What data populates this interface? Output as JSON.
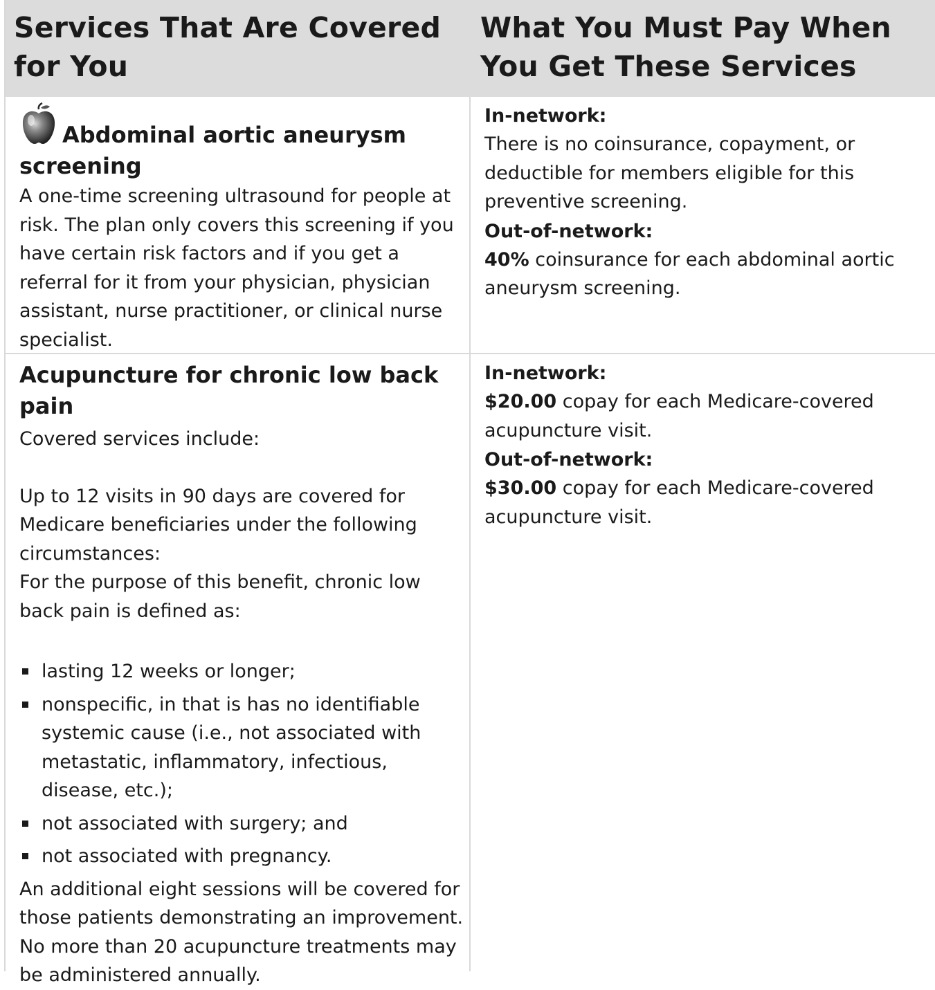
{
  "header": {
    "left": "Services That Are Covered for You",
    "right": "What You Must Pay When You Get These Services"
  },
  "rows": [
    {
      "icon": "apple-icon",
      "title": "Abdominal aortic aneurysm screening",
      "description": "A one-time screening ultrasound for people at risk. The plan only covers this screening if you have certain risk factors and if you get a referral for it from your physician, physician assistant, nurse practitioner, or clinical nurse specialist.",
      "in_network_label": "In-network:",
      "in_network_text": "There is no coinsurance, copayment, or deductible for members eligible for this preventive screening.",
      "out_network_label": "Out-of-network:",
      "out_network_amount": "40%",
      "out_network_text": " coinsurance for each abdominal aortic aneurysm screening."
    },
    {
      "title": "Acupuncture for chronic low back pain",
      "intro": "Covered services include:",
      "para1": "Up to 12 visits in 90 days are covered for Medicare beneficiaries under the following circumstances:",
      "para2": "For the purpose of this benefit, chronic low back pain is defined as:",
      "bullets": [
        "lasting 12 weeks or longer;",
        "nonspecific, in that is has no identifiable systemic cause (i.e., not associated with metastatic, inflammatory, infectious, disease, etc.);",
        "not associated with surgery; and",
        "not associated with pregnancy."
      ],
      "closing": "An additional eight sessions will be covered for those patients demonstrating an improvement. No more than 20 acupuncture treatments may be administered annually.",
      "in_network_label": "In-network:",
      "in_network_amount": "$20.00",
      "in_network_text": " copay for each Medicare-covered acupuncture visit.",
      "out_network_label": "Out-of-network:",
      "out_network_amount": "$30.00",
      "out_network_text": " copay for each Medicare-covered acupuncture visit."
    }
  ]
}
